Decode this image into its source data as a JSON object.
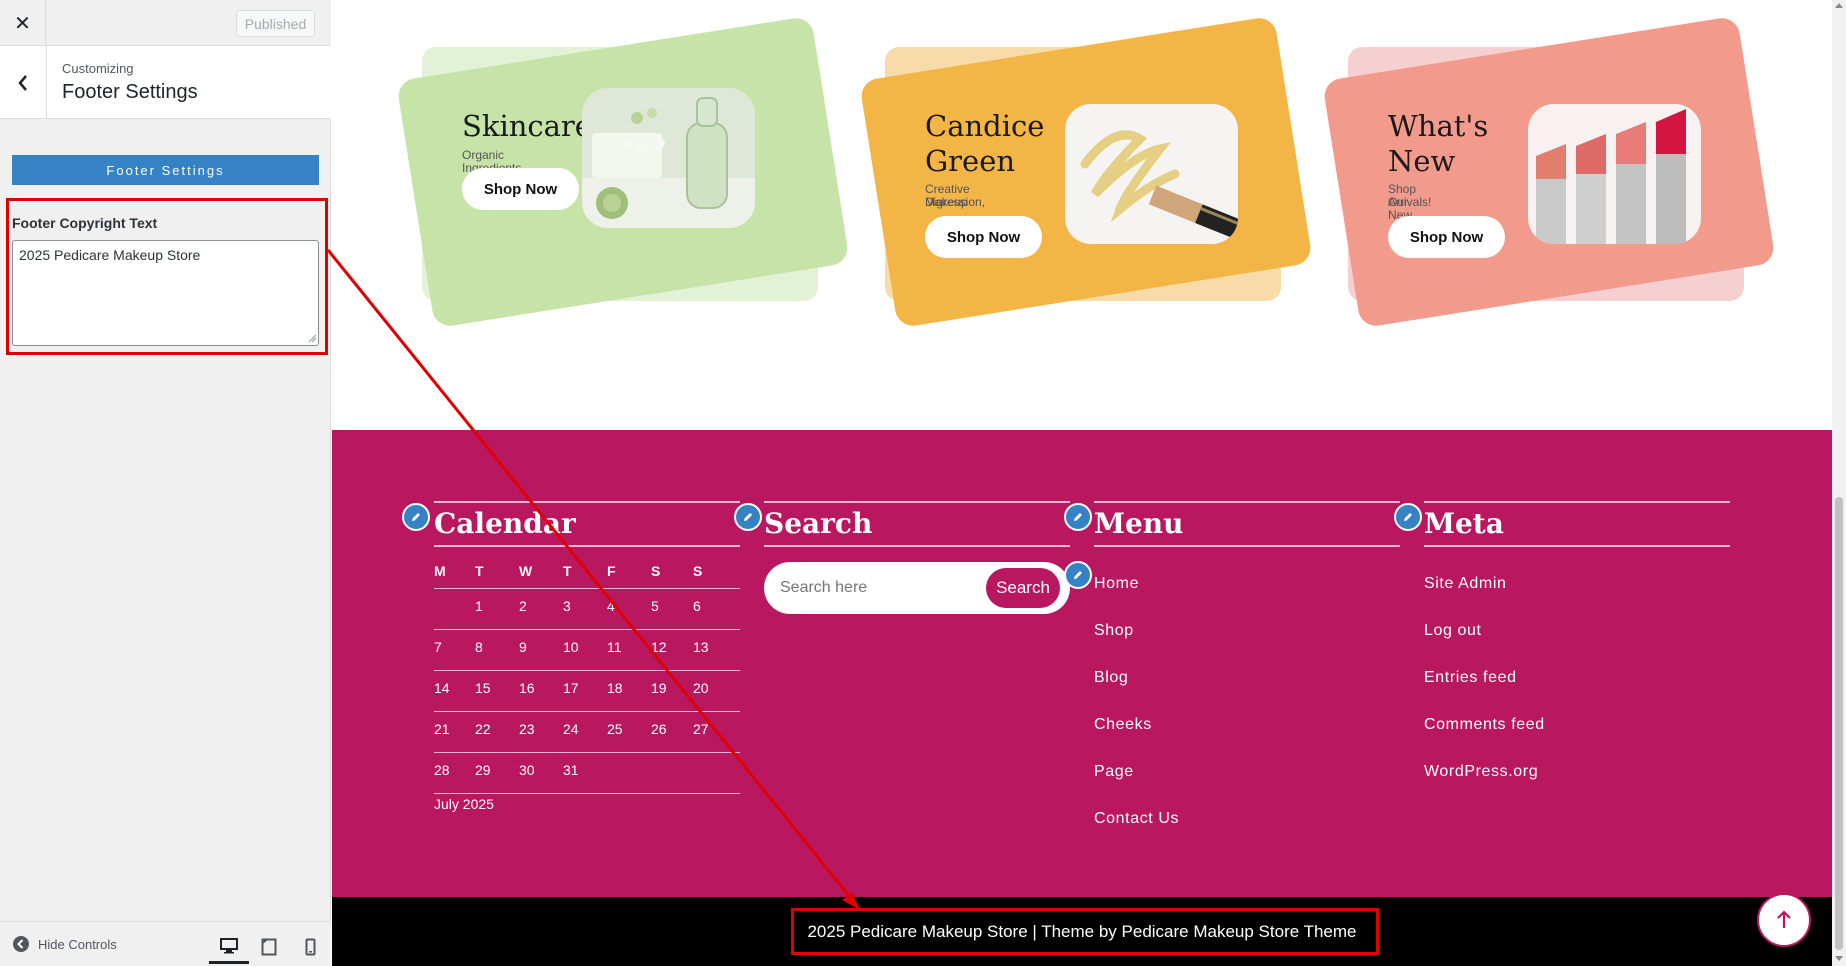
{
  "sidebar": {
    "close_icon": "close-icon",
    "publish_label": "Published",
    "breadcrumb": "Customizing",
    "title": "Footer Settings",
    "section_label": "Footer Settings",
    "copyright_label": "Footer Copyright Text",
    "copyright_value": "2025 Pedicare Makeup Store",
    "hide_controls": "Hide Controls"
  },
  "cards": [
    {
      "title_line1": "Skincare",
      "title_line2": "",
      "subtitle_line1": "Organic Ingredients",
      "subtitle_line2": "",
      "button": "Shop Now",
      "color": "#c6e4a8",
      "back_color": "#e3f1d7"
    },
    {
      "title_line1": "Candice",
      "title_line2": "Green",
      "subtitle_line1": "Creative Digression,",
      "subtitle_line2": "Makeup",
      "button": "Shop Now",
      "color": "#f4b547",
      "back_color": "#f7dcaa"
    },
    {
      "title_line1": "What's",
      "title_line2": "New",
      "subtitle_line1": "Shop Our New",
      "subtitle_line2": "Arrivals!",
      "button": "Shop Now",
      "color": "#f29a8c",
      "back_color": "#f6cfd0"
    }
  ],
  "footer": {
    "calendar": {
      "title": "Calendar",
      "days": [
        "M",
        "T",
        "W",
        "T",
        "F",
        "S",
        "S"
      ],
      "weeks": [
        [
          "",
          "1",
          "2",
          "3",
          "4",
          "5",
          "6"
        ],
        [
          "7",
          "8",
          "9",
          "10",
          "11",
          "12",
          "13"
        ],
        [
          "14",
          "15",
          "16",
          "17",
          "18",
          "19",
          "20"
        ],
        [
          "21",
          "22",
          "23",
          "24",
          "25",
          "26",
          "27"
        ],
        [
          "28",
          "29",
          "30",
          "31",
          "",
          "",
          ""
        ]
      ],
      "caption": "July 2025"
    },
    "search": {
      "title": "Search",
      "placeholder": "Search here",
      "button": "Search"
    },
    "menu": {
      "title": "Menu",
      "items": [
        "Home",
        "Shop",
        "Blog",
        "Cheeks",
        "Page",
        "Contact Us"
      ]
    },
    "meta": {
      "title": "Meta",
      "items": [
        "Site Admin",
        "Log out",
        "Entries feed",
        "Comments feed",
        "WordPress.org"
      ]
    },
    "copyright": "2025 Pedicare Makeup Store | Theme by Pedicare Makeup Store Theme"
  },
  "colors": {
    "accent": "#b9175f",
    "highlight": "#e00000",
    "wp_blue": "#3582c4"
  }
}
